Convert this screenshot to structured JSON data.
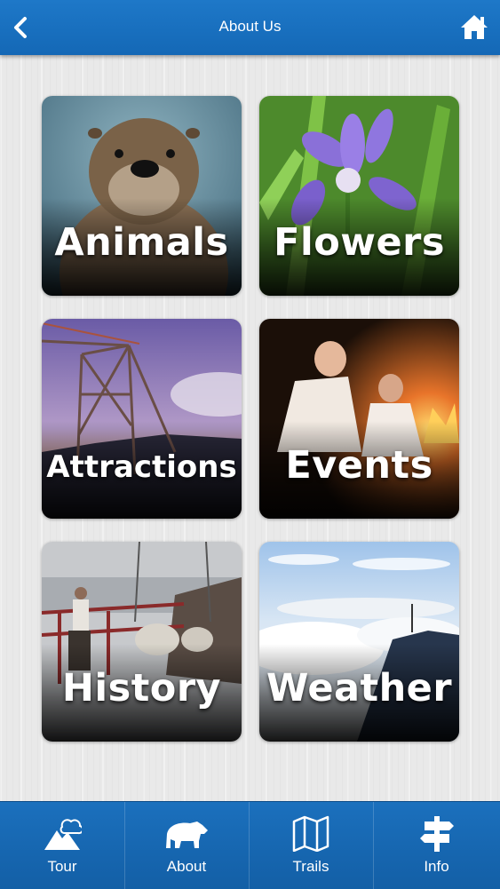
{
  "header": {
    "title": "About Us",
    "back_icon": "chevron-left-icon",
    "home_icon": "home-icon"
  },
  "tiles": [
    {
      "label": "Animals",
      "image": "otter-photo"
    },
    {
      "label": "Flowers",
      "image": "iris-flower-photo"
    },
    {
      "label": "Attractions",
      "image": "fire-tower-photo"
    },
    {
      "label": "Events",
      "image": "campfire-photo"
    },
    {
      "label": "History",
      "image": "tower-construction-photo"
    },
    {
      "label": "Weather",
      "image": "clouds-mountains-photo"
    }
  ],
  "tabbar": {
    "items": [
      {
        "label": "Tour",
        "icon": "mountain-cloud-icon"
      },
      {
        "label": "About",
        "icon": "bear-icon"
      },
      {
        "label": "Trails",
        "icon": "map-icon"
      },
      {
        "label": "Info",
        "icon": "signpost-icon"
      }
    ]
  },
  "colors": {
    "header_blue": "#1e78c8",
    "tabbar_blue": "#1468b6",
    "background": "#e9e9e9"
  }
}
